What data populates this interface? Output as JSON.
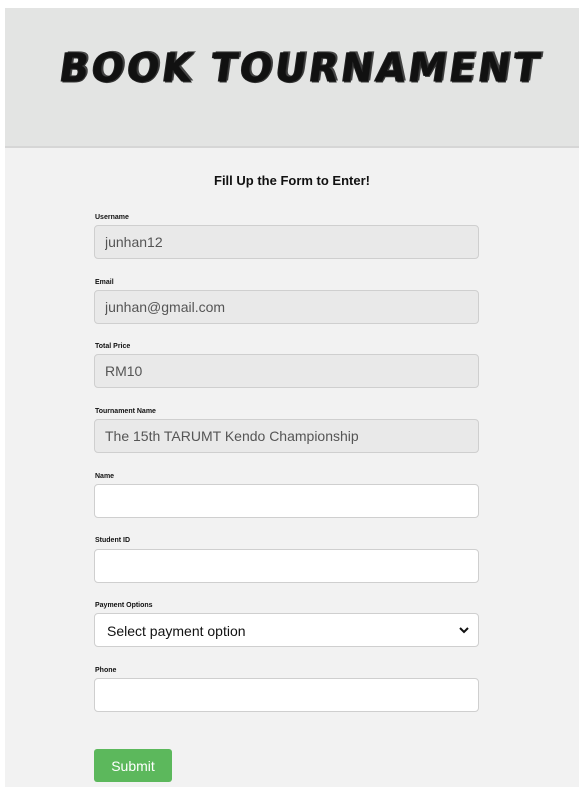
{
  "header": {
    "title": "BOOK TOURNAMENT"
  },
  "form": {
    "heading": "Fill Up the Form to Enter!",
    "username": {
      "label": "Username",
      "value": "junhan12"
    },
    "email": {
      "label": "Email",
      "value": "junhan@gmail.com"
    },
    "total_price": {
      "label": "Total Price",
      "value": "RM10"
    },
    "tournament_name": {
      "label": "Tournament Name",
      "value": "The 15th TARUMT Kendo Championship"
    },
    "name": {
      "label": "Name",
      "value": ""
    },
    "student_id": {
      "label": "Student ID",
      "value": ""
    },
    "payment": {
      "label": "Payment Options",
      "selected": "Select payment option"
    },
    "phone": {
      "label": "Phone",
      "value": ""
    },
    "submit_label": "Submit"
  },
  "colors": {
    "header_bg": "#e3e4e3",
    "page_bg": "#f2f2f2",
    "submit_bg": "#5cb85c"
  },
  "icons": {
    "select_arrow": "chevron-down-icon"
  }
}
